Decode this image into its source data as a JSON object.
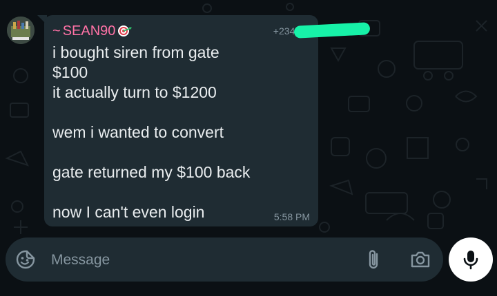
{
  "chat": {
    "avatar_icon": "contact-avatar",
    "message": {
      "sender_prefix": "~",
      "sender_name": "SEAN90",
      "sender_emoji": "dart-emoji",
      "sender_phone": "+234 7",
      "phone_redaction_color": "#17f2a8",
      "lines": [
        "i bought siren from gate",
        "$100",
        "it actually turn to $1200",
        "",
        "wem i wanted to convert",
        "",
        "gate returned my $100 back",
        "",
        "now I can't even login"
      ],
      "time": "5:58 PM"
    }
  },
  "composer": {
    "placeholder": "Message",
    "emoji_icon": "sticker-icon",
    "attach_icon": "paperclip-icon",
    "camera_icon": "camera-icon",
    "mic_icon": "microphone-icon"
  },
  "colors": {
    "background": "#0b1014",
    "bubble": "#1f2c33",
    "sender_name": "#ff72a6",
    "message_text": "#e9edef",
    "muted_text": "#8696a0",
    "mic_button": "#ffffff"
  }
}
